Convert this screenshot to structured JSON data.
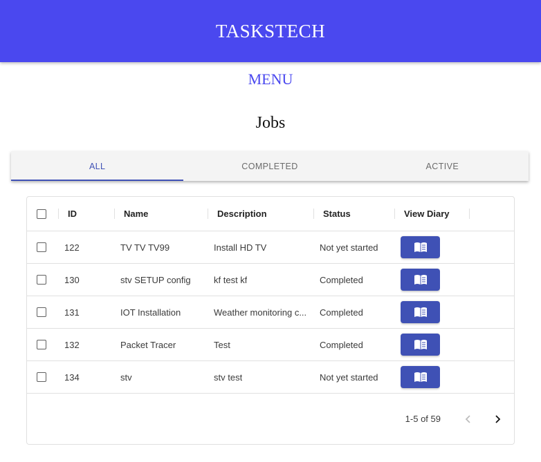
{
  "app": {
    "title": "TASKSTECH"
  },
  "menu": {
    "label": "MENU"
  },
  "page": {
    "title": "Jobs"
  },
  "tabs": [
    {
      "label": "ALL",
      "active": true
    },
    {
      "label": "COMPLETED",
      "active": false
    },
    {
      "label": "ACTIVE",
      "active": false
    }
  ],
  "table": {
    "columns": [
      "ID",
      "Name",
      "Description",
      "Status",
      "View Diary"
    ],
    "rows": [
      {
        "id": "122",
        "name": "TV TV TV99",
        "description": "Install HD TV",
        "status": "Not yet started"
      },
      {
        "id": "130",
        "name": "stv SETUP config",
        "description": "kf test kf",
        "status": "Completed"
      },
      {
        "id": "131",
        "name": "IOT Installation",
        "description": "Weather monitoring c...",
        "status": "Completed"
      },
      {
        "id": "132",
        "name": "Packet Tracer",
        "description": "Test",
        "status": "Completed"
      },
      {
        "id": "134",
        "name": "stv",
        "description": "stv test",
        "status": "Not yet started"
      }
    ]
  },
  "pagination": {
    "range": "1-5 of 59"
  },
  "colors": {
    "appbar": "#4a48ef",
    "accent": "#3f51b5"
  },
  "icons": {
    "diary": "book-icon",
    "prev": "chevron-left-icon",
    "next": "chevron-right-icon"
  }
}
